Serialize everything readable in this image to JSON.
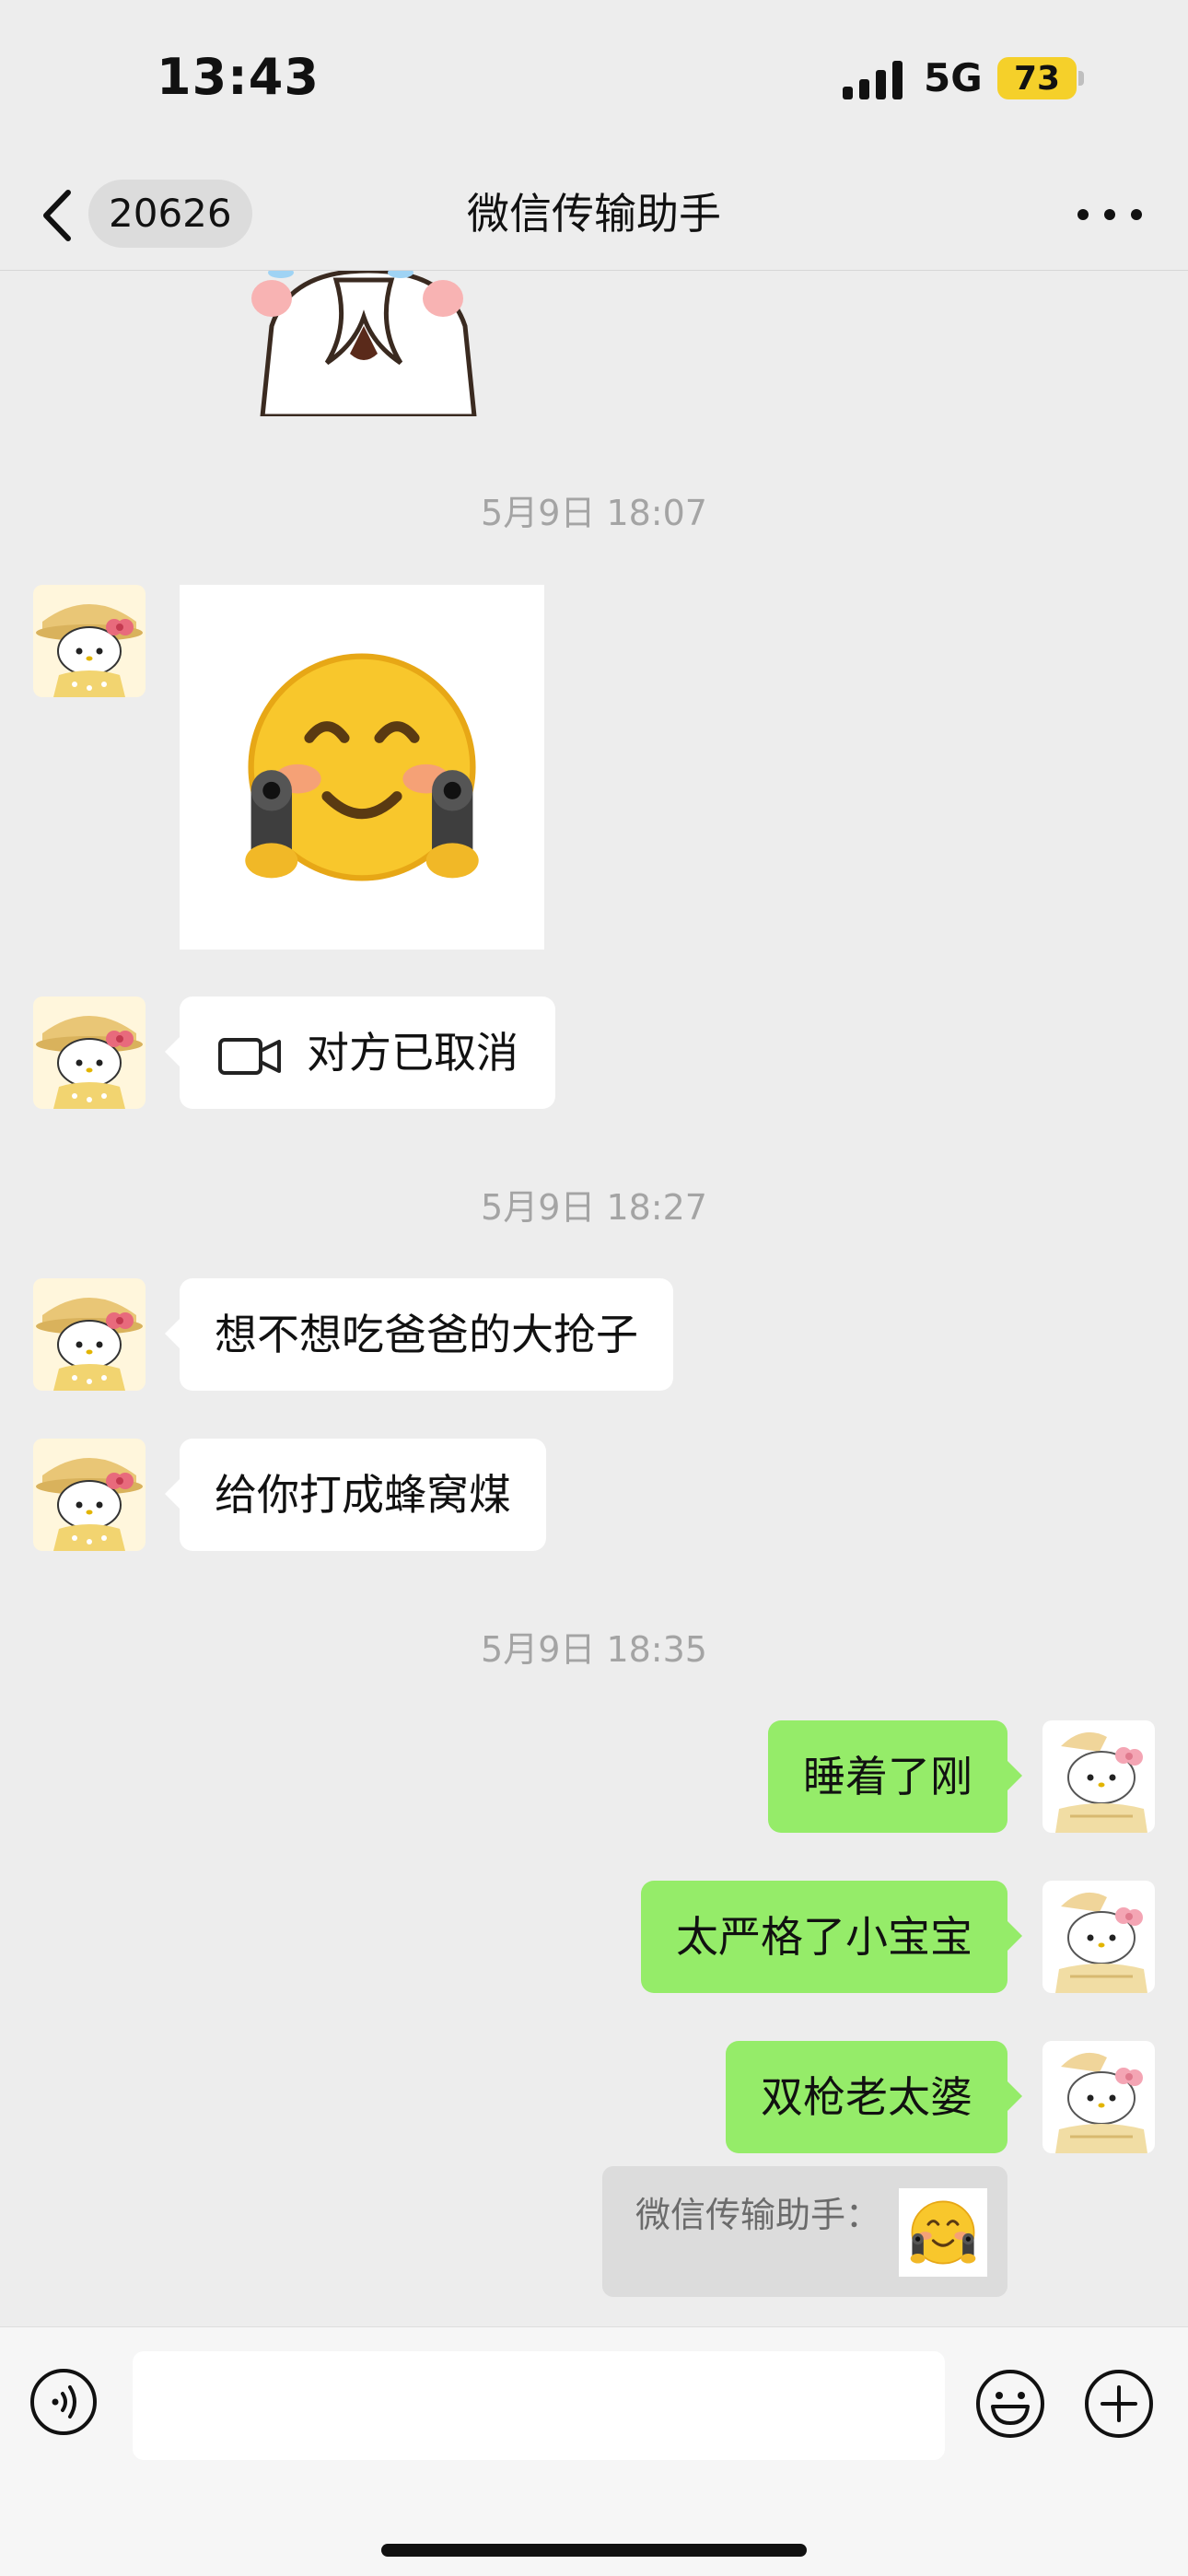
{
  "status_bar": {
    "time": "13:43",
    "network": "5G",
    "battery": "73"
  },
  "header": {
    "unread_count": "20626",
    "title": "微信传输助手"
  },
  "messages": {
    "ts1": "5月9日 18:07",
    "call_text": "对方已取消",
    "ts2": "5月9日 18:27",
    "in1": "想不想吃爸爸的大抢子",
    "in2": "给你打成蜂窝煤",
    "ts3": "5月9日 18:35",
    "out1": "睡着了刚",
    "out2": "太严格了小宝宝",
    "out3": "双枪老太婆",
    "quote_label": "微信传输助手："
  },
  "icons": {
    "back": "chevron-left-icon",
    "more": "more-dots-icon",
    "video_call": "video-camera-icon",
    "voice": "voice-input-icon",
    "emoji": "emoji-face-icon",
    "plus": "plus-circle-icon"
  },
  "colors": {
    "background": "#EDEDED",
    "outgoing_bubble": "#95EC69",
    "incoming_bubble": "#FFFFFF",
    "battery": "#F5D02A"
  },
  "input": {
    "value": ""
  }
}
